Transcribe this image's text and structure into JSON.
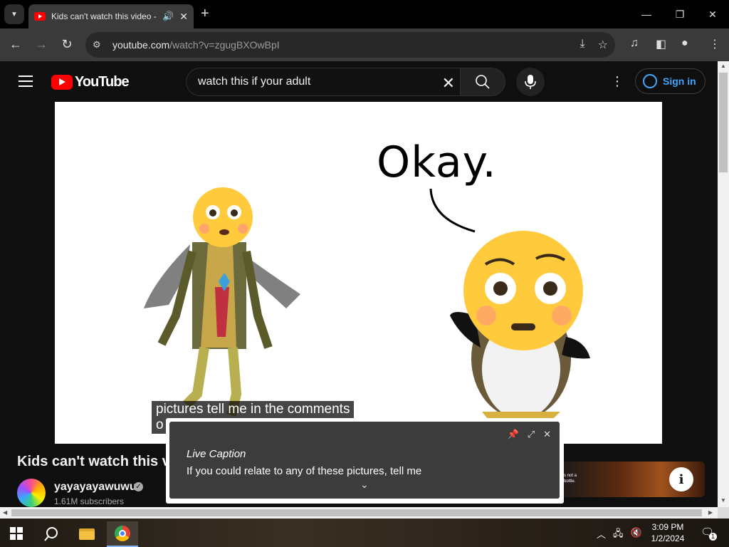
{
  "browser": {
    "tab_title": "Kids can't watch this video -",
    "url_host": "youtube.com",
    "url_path": "/watch?v=zgugBXOwBpI"
  },
  "youtube": {
    "logo_text": "YouTube",
    "search_value": "watch this if your adult",
    "signin_label": "Sign in"
  },
  "video": {
    "overlay_text": "Okay.",
    "caption_line1": "pictures tell me in the comments",
    "caption_line2": "o"
  },
  "live_caption": {
    "title": "Live Caption",
    "text": "If you could relate to any of these pictures, tell me"
  },
  "below_video": {
    "title": "Kids can't watch this vid",
    "channel_name": "yayayayawuwu",
    "subscribers": "1.61M subscribers",
    "ad_text_line1": "s not a",
    "ad_text_line2": "bottle."
  },
  "taskbar": {
    "time": "3:09 PM",
    "date": "1/2/2024",
    "notification_count": "1"
  },
  "colors": {
    "youtube_red": "#ff0000",
    "link_blue": "#3ea6ff",
    "page_bg": "#0f0f0f"
  }
}
